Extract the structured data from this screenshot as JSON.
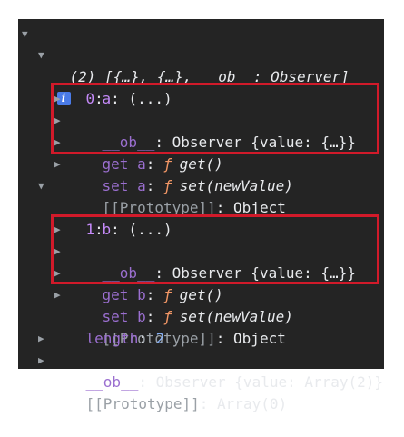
{
  "root": {
    "summary_prefix": "(2) ",
    "summary": "[{…}, {…}, __ob__: Observer]",
    "info_glyph": "i"
  },
  "items": [
    {
      "index": "0",
      "prop_key": "a",
      "prop_value": " (...)",
      "ob_key": "__ob__",
      "ob_value": " Observer {value: {…}}",
      "getter_label": "get a",
      "getter_f": "ƒ",
      "getter_fn": "get()",
      "setter_label": "set a",
      "setter_f": "ƒ",
      "setter_fn": "set(newValue)",
      "proto_key": "[[Prototype]]",
      "proto_value": " Object"
    },
    {
      "index": "1",
      "prop_key": "b",
      "prop_value": " (...)",
      "ob_key": "__ob__",
      "ob_value": " Observer {value: {…}}",
      "getter_label": "get b",
      "getter_f": "ƒ",
      "getter_fn": "get()",
      "setter_label": "set b",
      "setter_f": "ƒ",
      "setter_fn": "set(newValue)",
      "proto_key": "[[Prototype]]",
      "proto_value": " Object"
    }
  ],
  "length_key": "length",
  "length_value": "2",
  "array_ob_key": "__ob__",
  "array_ob_value": " Observer {value: Array(2)}",
  "array_proto_key": "[[Prototype]]",
  "array_proto_value": " Array(0)",
  "icons": {
    "expanded": "expanded-triangle-icon",
    "collapsed": "collapsed-triangle-icon",
    "info": "info-icon"
  },
  "colors": {
    "background": "#242424",
    "key": "#c58af9",
    "getter_f": "#f29766",
    "number": "#8ab4f8",
    "highlight": "#d11a2a"
  }
}
